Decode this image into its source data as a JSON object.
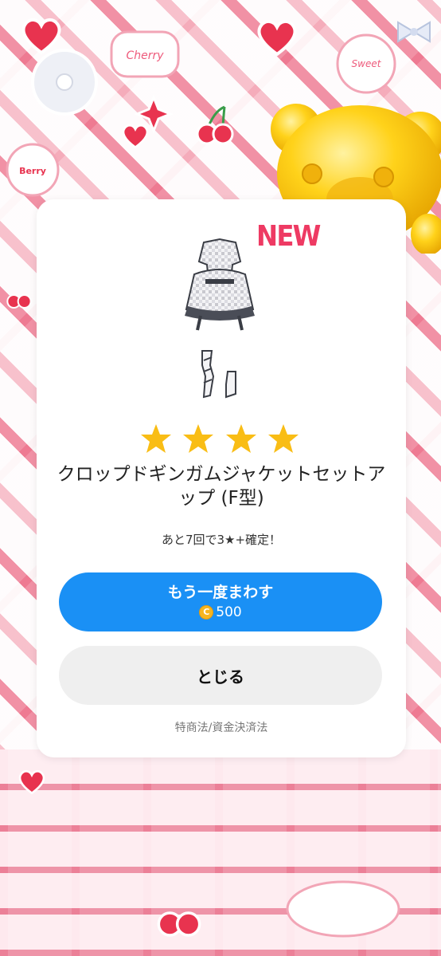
{
  "result_card": {
    "new_label": "NEW",
    "rarity_stars": 4,
    "item_name": "クロップドギンガムジャケットセットアップ (F型)",
    "guarantee_note": "あと7回で3★+確定！"
  },
  "actions": {
    "spin_again_label": "もう一度まわす",
    "coin_icon_glyph": "C",
    "spin_cost": "500",
    "close_label": "とじる"
  },
  "footer": {
    "legal_link": "特商法/資金決済法"
  },
  "colors": {
    "accent_blue": "#1a90f5",
    "star_yellow": "#f9bd15",
    "new_pink": "#ee3a63",
    "coin_gold": "#f6b520"
  },
  "icons": {
    "stars": "star-icon",
    "coin": "coin-icon",
    "bear": "gold-bear-mascot"
  }
}
